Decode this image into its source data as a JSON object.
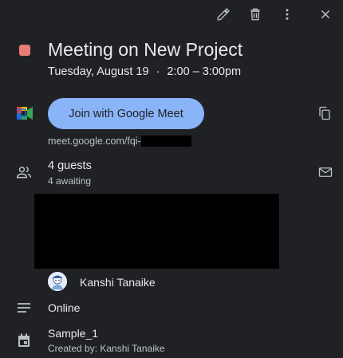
{
  "toolbar": {
    "edit_icon": "pencil-icon",
    "delete_icon": "trash-icon",
    "more_icon": "more-vertical-icon",
    "close_icon": "close-icon"
  },
  "event": {
    "color": "#e67c73",
    "title": "Meeting on New Project",
    "date": "Tuesday, August 19",
    "separator": "·",
    "time": "2:00 – 3:00pm"
  },
  "meet": {
    "join_label": "Join with Google Meet",
    "link_prefix": "meet.google.com/fqi-",
    "copy_icon": "copy-icon"
  },
  "guests": {
    "count_label": "4 guests",
    "status_label": "4 awaiting",
    "email_icon": "mail-icon",
    "visible_guest_name": "Kanshi Tanaike"
  },
  "description": {
    "text": "Online"
  },
  "calendar": {
    "name": "Sample_1",
    "created_by": "Created by: Kanshi Tanaike"
  },
  "colors": {
    "background": "#202124",
    "accent": "#8ab4f8",
    "text_primary": "#e8eaed",
    "text_secondary": "#bdc1c6"
  }
}
